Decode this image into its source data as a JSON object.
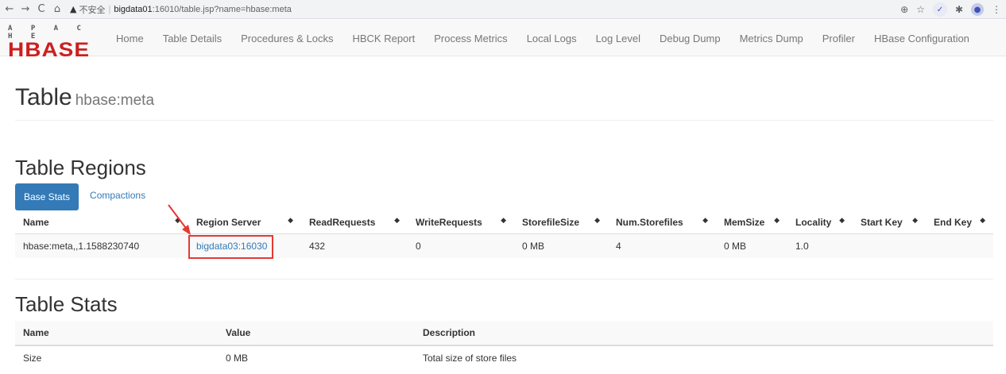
{
  "browser": {
    "back": "←",
    "forward": "→",
    "reload": "C",
    "home": "⌂",
    "warning_icon": "▲",
    "insecure_label": "不安全",
    "separator": "|",
    "url_host": "bigdata01",
    "url_path": ":16010/table.jsp?name=hbase:meta",
    "zoom_icon": "⊕",
    "star_icon": "☆",
    "ext_icon": "✓",
    "puzzle_icon": "✱",
    "menu_icon": "⋮"
  },
  "logo": {
    "top": "A P A C H E",
    "main": "HBASE",
    "color": "#cc1f1f"
  },
  "nav": {
    "items": [
      "Home",
      "Table Details",
      "Procedures & Locks",
      "HBCK Report",
      "Process Metrics",
      "Local Logs",
      "Log Level",
      "Debug Dump",
      "Metrics Dump",
      "Profiler",
      "HBase Configuration"
    ]
  },
  "page": {
    "title": "Table",
    "table_name": "hbase:meta"
  },
  "regions": {
    "heading": "Table Regions",
    "tabs": [
      "Base Stats",
      "Compactions"
    ],
    "columns": [
      "Name",
      "Region Server",
      "ReadRequests",
      "WriteRequests",
      "StorefileSize",
      "Num.Storefiles",
      "MemSize",
      "Locality",
      "Start Key",
      "End Key"
    ],
    "sort_icon": "◆",
    "rows": [
      [
        "hbase:meta,,1.1588230740",
        "bigdata03:16030",
        "432",
        "0",
        "0 MB",
        "4",
        "0 MB",
        "1.0",
        "",
        ""
      ]
    ]
  },
  "stats": {
    "heading": "Table Stats",
    "columns": [
      "Name",
      "Value",
      "Description"
    ],
    "rows": [
      [
        "Size",
        "0 MB",
        "Total size of store files"
      ]
    ]
  },
  "annotation": {
    "color": "#e53935"
  }
}
